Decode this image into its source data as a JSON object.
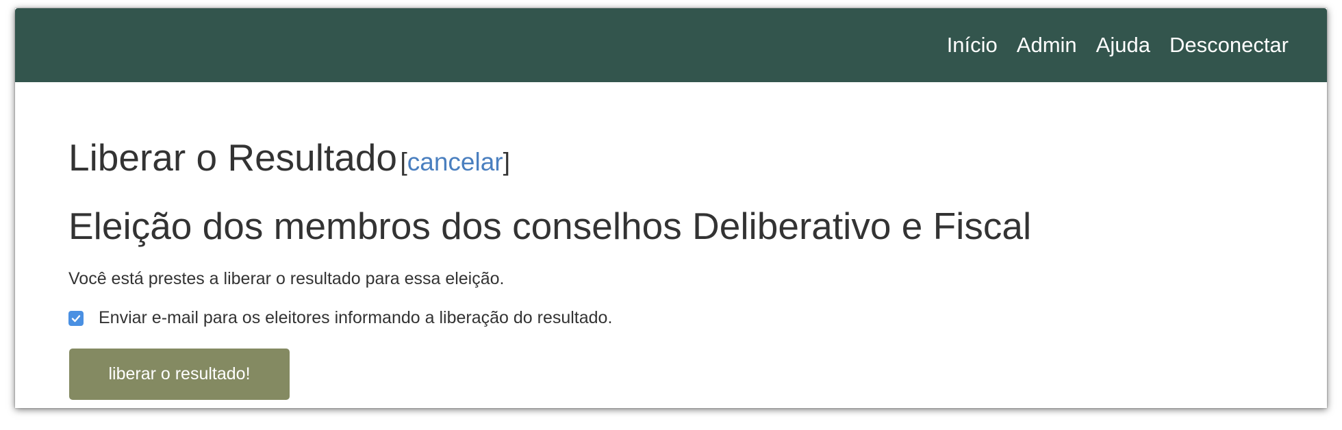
{
  "nav": {
    "items": [
      {
        "label": "Início"
      },
      {
        "label": "Admin"
      },
      {
        "label": "Ajuda"
      },
      {
        "label": "Desconectar"
      }
    ]
  },
  "page": {
    "title": "Liberar o Resultado",
    "cancel_open": "[",
    "cancel_label": "cancelar",
    "cancel_close": "]",
    "election_name": "Eleição dos membros dos conselhos Deliberativo e Fiscal",
    "info_text": "Você está prestes a liberar o resultado para essa eleição.",
    "email_checkbox_label": "Enviar e-mail para os eleitores informando a liberação do resultado.",
    "email_checkbox_checked": true,
    "release_button_label": "liberar o resultado!"
  },
  "colors": {
    "navbar": "#33554d",
    "link": "#4a7fbf",
    "button": "#848a62",
    "checkbox": "#4a90e2"
  }
}
